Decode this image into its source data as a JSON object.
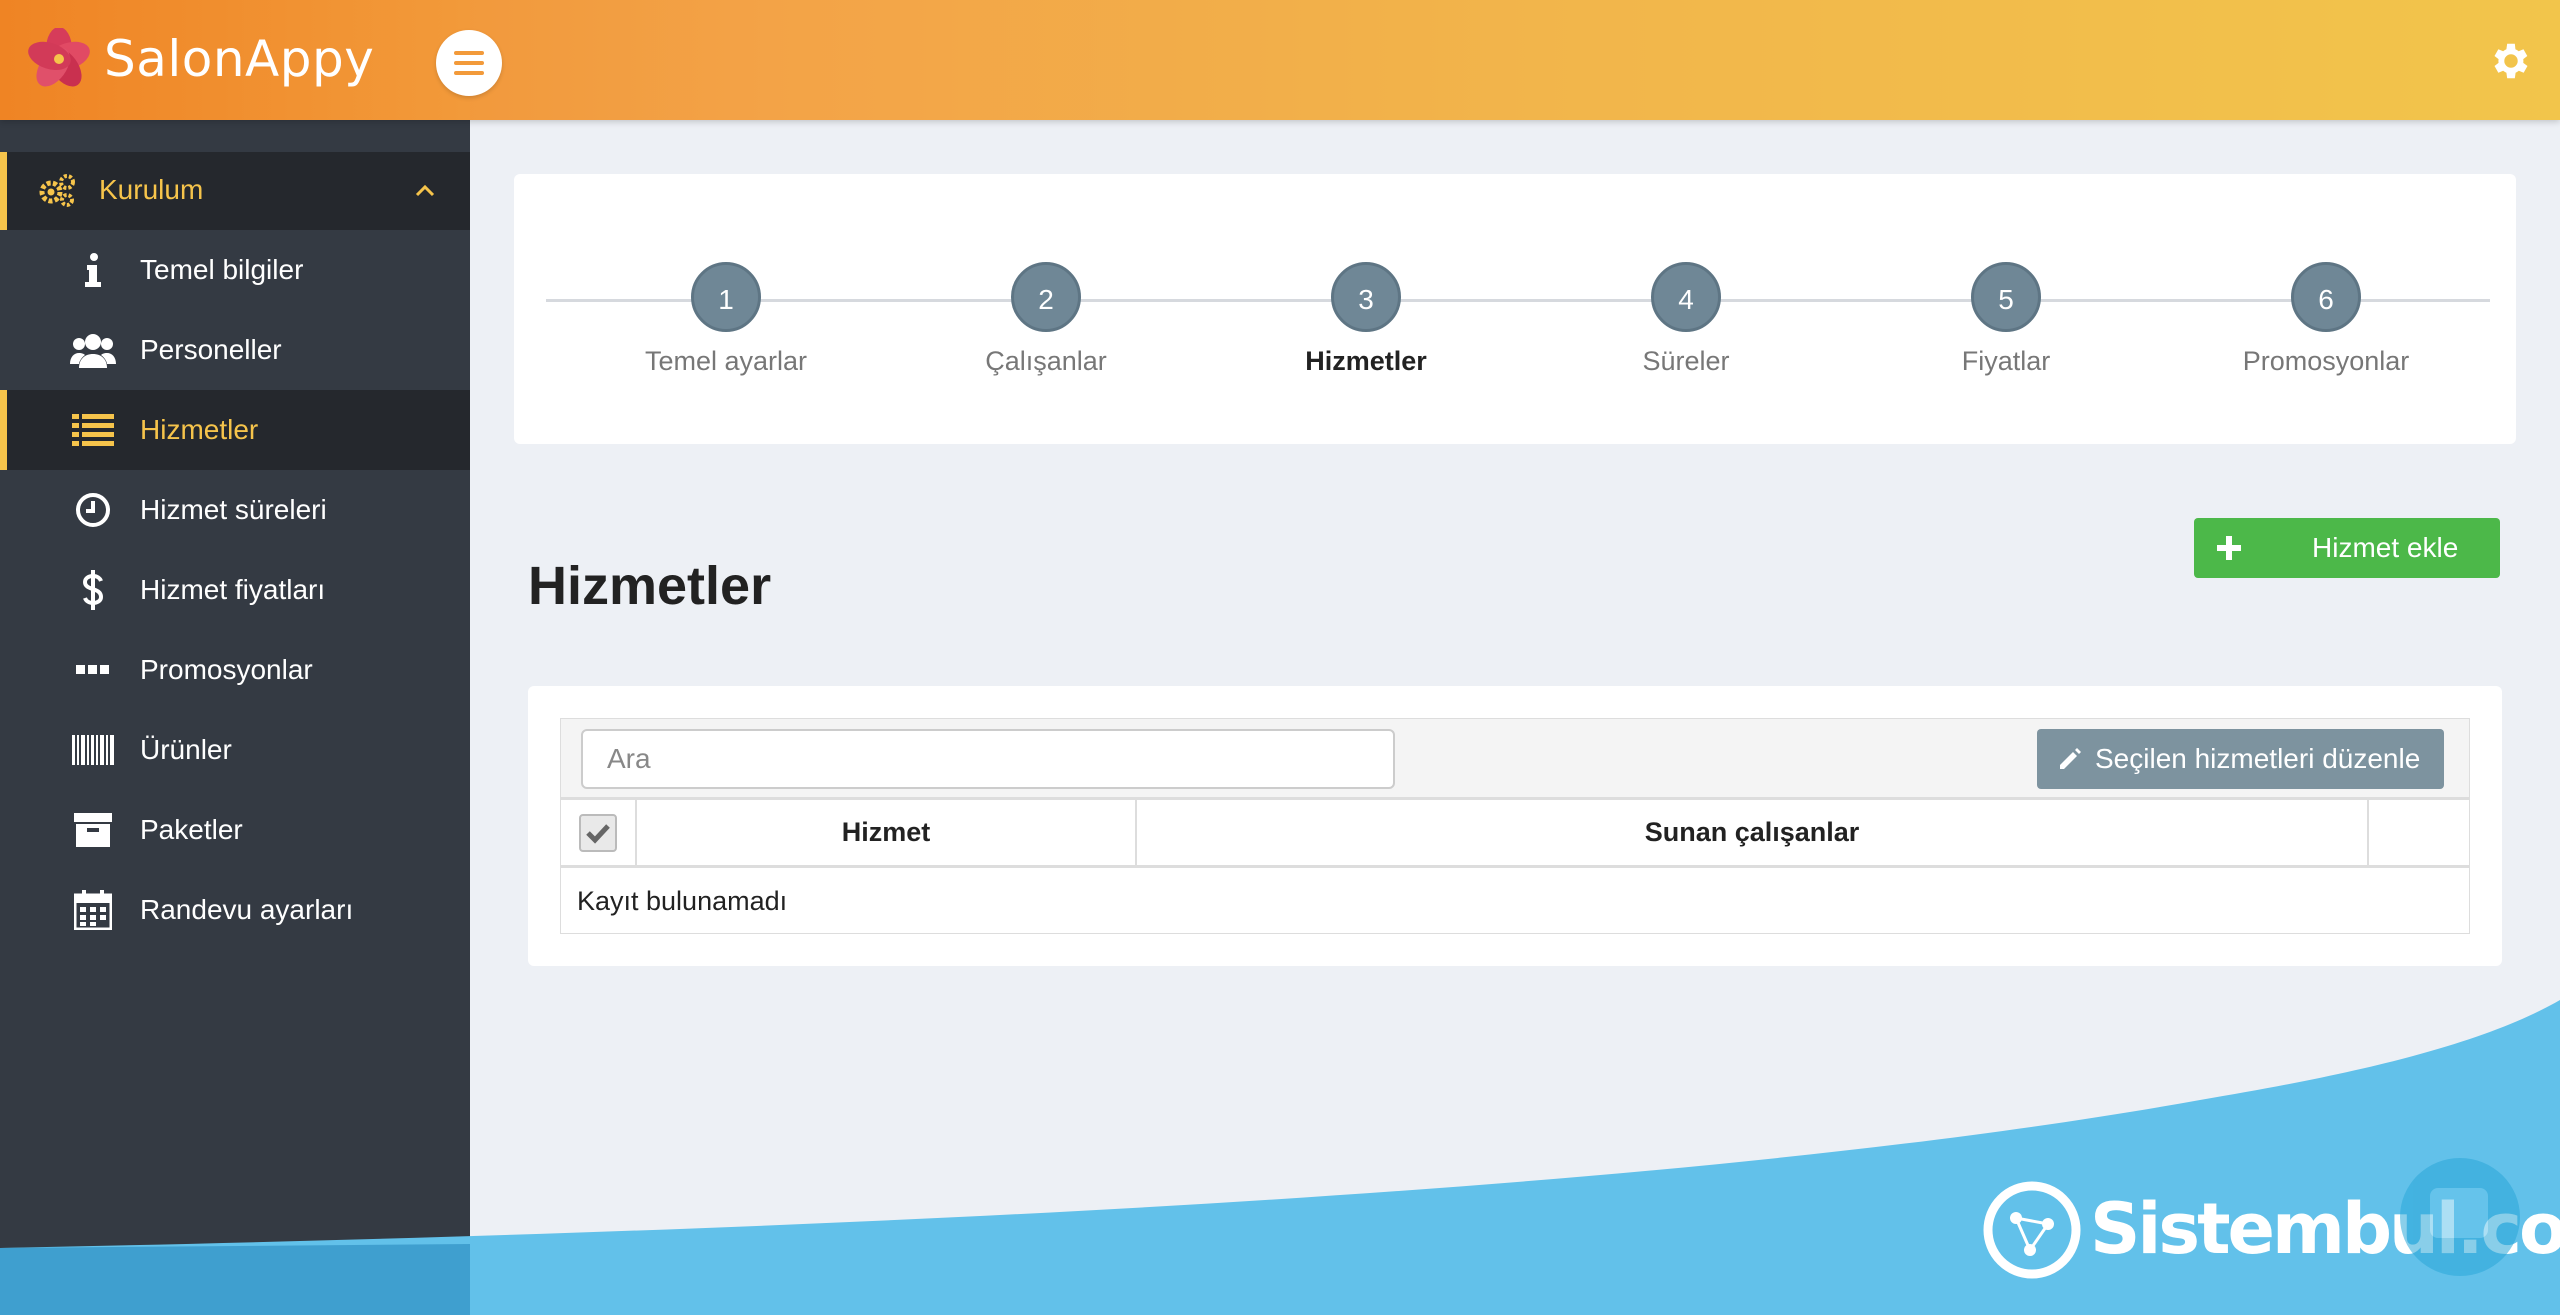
{
  "brand": {
    "name": "SalonAppy"
  },
  "sidebar": {
    "section": {
      "label": "Kurulum"
    },
    "items": [
      {
        "label": "Temel bilgiler",
        "icon": "info-icon"
      },
      {
        "label": "Personeller",
        "icon": "users-icon"
      },
      {
        "label": "Hizmetler",
        "icon": "list-icon",
        "active": true
      },
      {
        "label": "Hizmet süreleri",
        "icon": "clock-icon"
      },
      {
        "label": "Hizmet fiyatları",
        "icon": "dollar-icon"
      },
      {
        "label": "Promosyonlar",
        "icon": "ellipsis-icon"
      },
      {
        "label": "Ürünler",
        "icon": "barcode-icon"
      },
      {
        "label": "Paketler",
        "icon": "archive-icon"
      },
      {
        "label": "Randevu ayarları",
        "icon": "calendar-icon"
      }
    ]
  },
  "steps": [
    {
      "number": "1",
      "label": "Temel ayarlar"
    },
    {
      "number": "2",
      "label": "Çalışanlar"
    },
    {
      "number": "3",
      "label": "Hizmetler",
      "current": true
    },
    {
      "number": "4",
      "label": "Süreler"
    },
    {
      "number": "5",
      "label": "Fiyatlar"
    },
    {
      "number": "6",
      "label": "Promosyonlar"
    }
  ],
  "main": {
    "title": "Hizmetler",
    "add_button": "Hizmet ekle",
    "search_placeholder": "Ara",
    "edit_selected_button": "Seçilen hizmetleri düzenle",
    "columns": [
      "Hizmet",
      "Sunan çalışanlar"
    ],
    "empty_message": "Kayıt bulunamadı"
  },
  "watermark": {
    "text": "Sistembul.com"
  },
  "colors": {
    "accent": "#f6c44b",
    "header_start": "#f08a2c",
    "header_end": "#f2c54b",
    "sidebar_bg": "#343a43",
    "step_circle": "#6f8796",
    "add_button": "#4cb849",
    "edit_button": "#7d939f",
    "wave": "#62c1ea"
  }
}
